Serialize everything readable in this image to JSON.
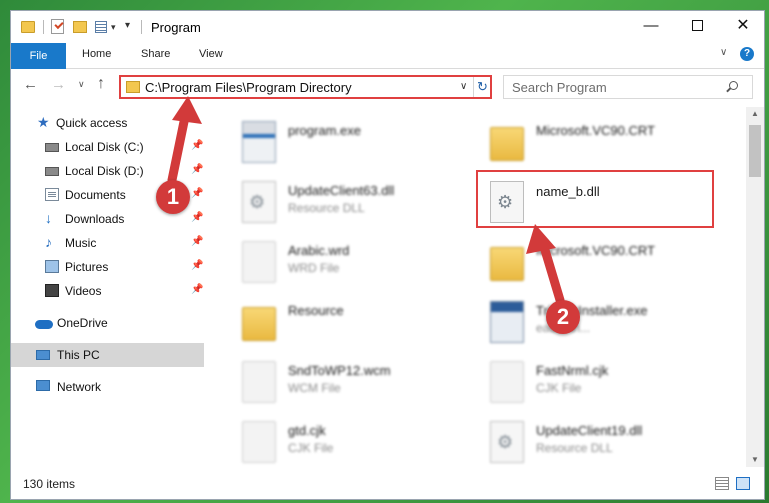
{
  "window": {
    "title": "Program",
    "controls": {
      "minimize": "—",
      "maximize": "",
      "close": "✕"
    }
  },
  "ribbon": {
    "tabs": [
      "File",
      "Home",
      "Share",
      "View"
    ]
  },
  "address": {
    "path": "C:\\Program Files\\Program Directory",
    "search_placeholder": "Search Program"
  },
  "sidebar": {
    "items": [
      {
        "label": "Quick access",
        "icon": "star-icon"
      },
      {
        "label": "Local Disk (C:)",
        "icon": "disk-icon"
      },
      {
        "label": "Local Disk (D:)",
        "icon": "disk-icon"
      },
      {
        "label": "Documents",
        "icon": "documents-icon"
      },
      {
        "label": "Downloads",
        "icon": "download-icon"
      },
      {
        "label": "Music",
        "icon": "music-icon"
      },
      {
        "label": "Pictures",
        "icon": "pictures-icon"
      },
      {
        "label": "Videos",
        "icon": "videos-icon"
      },
      {
        "label": "OneDrive",
        "icon": "cloud-icon"
      },
      {
        "label": "This PC",
        "icon": "pc-icon"
      },
      {
        "label": "Network",
        "icon": "network-icon"
      }
    ]
  },
  "files": [
    {
      "name": "program.exe",
      "type": ""
    },
    {
      "name": "Microsoft.VC90.CRT",
      "type": ""
    },
    {
      "name": "UpdateClient63.dll",
      "type": "Resource DLL"
    },
    {
      "name": "name_b.dll",
      "type": ""
    },
    {
      "name": "Arabic.wrd",
      "type": "WRD File"
    },
    {
      "name": "Microsoft.VC90.CRT",
      "type": ""
    },
    {
      "name": "Resource",
      "type": ""
    },
    {
      "name": "TrialMsInstaller.exe",
      "type": "eader tri..."
    },
    {
      "name": "SndToWP12.wcm",
      "type": "WCM File"
    },
    {
      "name": "FastNrml.cjk",
      "type": "CJK File"
    },
    {
      "name": "gtd.cjk",
      "type": "CJK File"
    },
    {
      "name": "UpdateClient19.dll",
      "type": "Resource DLL"
    }
  ],
  "status": {
    "item_count": "130 items"
  },
  "annotations": {
    "step1": "1",
    "step2": "2"
  },
  "colors": {
    "accent": "#1979ca",
    "highlight": "#e04040",
    "badge": "#d23a3a"
  }
}
